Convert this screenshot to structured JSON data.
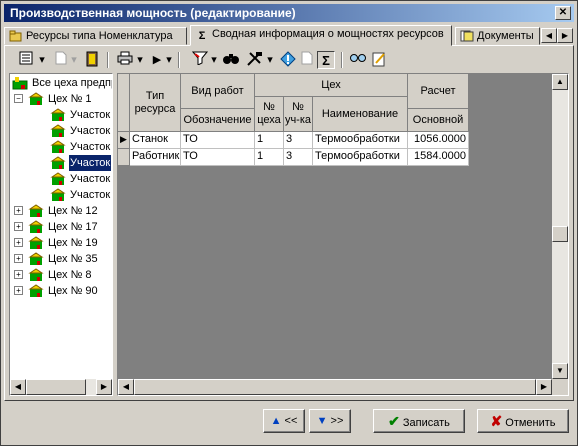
{
  "window": {
    "title": "Производственная мощность (редактирование)"
  },
  "tabs": [
    {
      "label": "Ресурсы типа Номенклатура",
      "icon": "folder-key-icon"
    },
    {
      "label": "Сводная информация о мощностях ресурсов",
      "icon": "sigma-icon"
    },
    {
      "label": "Документы",
      "icon": "documents-icon"
    }
  ],
  "toolbar": {
    "sigma_label": "Σ"
  },
  "tree": {
    "root": "Все цеха предпр",
    "nodes": [
      {
        "label": "Цех № 1",
        "expanded": true,
        "children": [
          "Участок",
          "Участок",
          "Участок",
          "Участок",
          "Участок",
          "Участок"
        ],
        "selected_child": 3
      },
      {
        "label": "Цех № 12"
      },
      {
        "label": "Цех № 17"
      },
      {
        "label": "Цех № 19"
      },
      {
        "label": "Цех № 35"
      },
      {
        "label": "Цех № 8"
      },
      {
        "label": "Цех № 90"
      }
    ]
  },
  "grid": {
    "headers": {
      "resource_type": "Тип ресурса",
      "work_type": "Вид работ",
      "designation": "Обозначение",
      "shop": "Цех",
      "shop_no": "№ цеха",
      "section_no": "№ уч-ка",
      "name": "Наименование",
      "calc": "Расчет",
      "main": "Основной"
    },
    "rows": [
      {
        "resource_type": "Станок",
        "designation": "ТО",
        "shop_no": "1",
        "section_no": "3",
        "name": "Термообработки",
        "main": "1056.0000"
      },
      {
        "resource_type": "Работник",
        "designation": "ТО",
        "shop_no": "1",
        "section_no": "3",
        "name": "Термообработки",
        "main": "1584.0000"
      }
    ]
  },
  "buttons": {
    "prev": "<<",
    "next": ">>",
    "save": "Записать",
    "cancel": "Отменить"
  }
}
